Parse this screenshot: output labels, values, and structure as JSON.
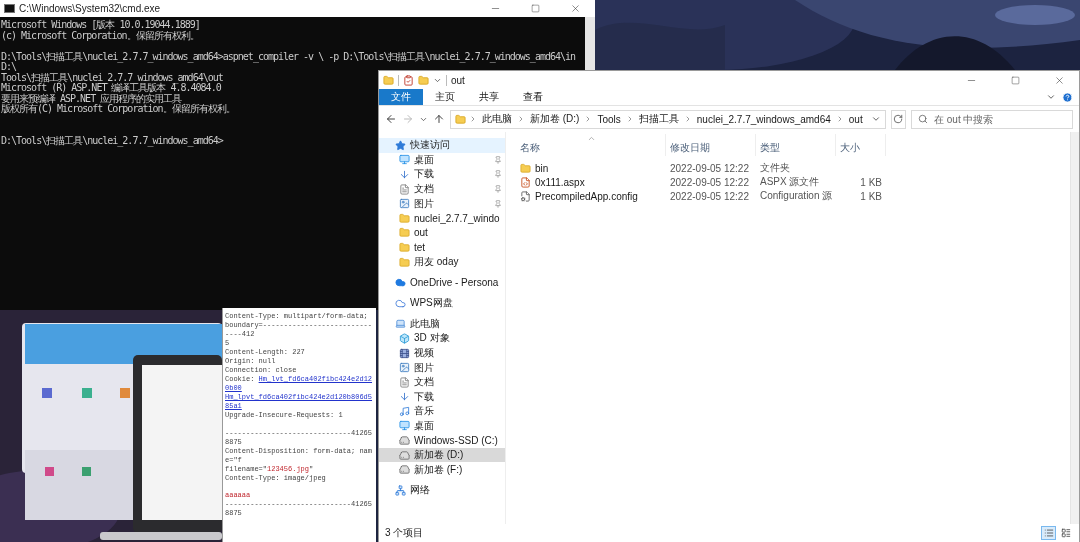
{
  "cmd_window": {
    "title": "C:\\Windows\\System32\\cmd.exe",
    "lines": [
      {
        "kind": "text",
        "text": "Microsoft Windows [版本 10.0.19044.1889]"
      },
      {
        "kind": "text",
        "text": "(c) Microsoft Corporation。保留所有权利。"
      },
      {
        "kind": "blank"
      },
      {
        "kind": "text",
        "text": "D:\\Tools\\扫描工具\\nuclei_2.7.7_windows_amd64>aspnet_compiler -v \\ -p D:\\Tools\\扫描工具\\nuclei_2.7.7_windows_amd64\\in D:\\"
      },
      {
        "kind": "text",
        "text": "Tools\\扫描工具\\nuclei_2.7.7_windows_amd64\\out"
      },
      {
        "kind": "text",
        "text": "Microsoft (R) ASP.NET 编译工具版本 4.8.4084.0"
      },
      {
        "kind": "text",
        "text": "要用来预编译 ASP.NET 应用程序的实用工具"
      },
      {
        "kind": "text",
        "text": "版权所有(C) Microsoft Corporation。保留所有权利。"
      },
      {
        "kind": "blank"
      },
      {
        "kind": "blank"
      },
      {
        "kind": "text",
        "text": "D:\\Tools\\扫描工具\\nuclei_2.7.7_windows_amd64>"
      }
    ]
  },
  "request_panel": {
    "lines": [
      {
        "kind": "text",
        "segments": [
          {
            "kind": "plain",
            "text": "Content-Type: multipart/form-data;"
          }
        ]
      },
      {
        "kind": "text",
        "segments": [
          {
            "kind": "plain",
            "text": "boundary=------------------------------412"
          }
        ]
      },
      {
        "kind": "text",
        "segments": [
          {
            "kind": "plain",
            "text": "5"
          }
        ]
      },
      {
        "kind": "text",
        "segments": [
          {
            "kind": "plain",
            "text": "Content-Length: 227"
          }
        ]
      },
      {
        "kind": "text",
        "segments": [
          {
            "kind": "plain",
            "text": "Origin: null"
          }
        ]
      },
      {
        "kind": "text",
        "segments": [
          {
            "kind": "plain",
            "text": "Connection: close"
          }
        ]
      },
      {
        "kind": "text",
        "segments": [
          {
            "kind": "plain",
            "text": "Cookie: "
          },
          {
            "kind": "link",
            "text": "Hm_lvt_fd6ca402fibc424e2d120b00"
          }
        ]
      },
      {
        "kind": "text",
        "segments": [
          {
            "kind": "link",
            "text": "Hm_lpvt_fd6ca402fibc424e2d120b806d585a1"
          }
        ]
      },
      {
        "kind": "text",
        "segments": [
          {
            "kind": "plain",
            "text": "Upgrade-Insecure-Requests: 1"
          }
        ]
      },
      {
        "kind": "blank"
      },
      {
        "kind": "text",
        "segments": [
          {
            "kind": "plain",
            "text": "------------------------------412658875"
          }
        ]
      },
      {
        "kind": "text",
        "segments": [
          {
            "kind": "plain",
            "text": "Content-Disposition: form-data; name=\"f"
          }
        ]
      },
      {
        "kind": "text",
        "segments": [
          {
            "kind": "plain",
            "text": "filename=\""
          },
          {
            "kind": "value",
            "text": "123456.jpg"
          },
          {
            "kind": "plain",
            "text": "\""
          }
        ]
      },
      {
        "kind": "text",
        "segments": [
          {
            "kind": "plain",
            "text": "Content-Type: image/jpeg"
          }
        ]
      },
      {
        "kind": "blank"
      },
      {
        "kind": "text",
        "segments": [
          {
            "kind": "value",
            "text": "aaaaaa"
          }
        ]
      },
      {
        "kind": "text",
        "segments": [
          {
            "kind": "plain",
            "text": "------------------------------412658875"
          }
        ]
      }
    ]
  },
  "explorer": {
    "title": "out",
    "ribbon_tabs": [
      {
        "label": "文件",
        "selected": true
      },
      {
        "label": "主页",
        "selected": false
      },
      {
        "label": "共享",
        "selected": false
      },
      {
        "label": "查看",
        "selected": false
      }
    ],
    "breadcrumb": [
      "此电脑",
      "新加卷 (D:)",
      "Tools",
      "扫描工具",
      "nuclei_2.7.7_windows_amd64",
      "out"
    ],
    "search": {
      "placeholder": "在 out 中搜索"
    },
    "nav": [
      {
        "label": "快速访问",
        "kind": "star",
        "selected": false,
        "hovered": true,
        "children": [
          {
            "label": "桌面",
            "kind": "desktop",
            "pinned": true,
            "selected": false,
            "hovered": false
          },
          {
            "label": "下载",
            "kind": "download",
            "pinned": true,
            "selected": false,
            "hovered": false
          },
          {
            "label": "文档",
            "kind": "document",
            "pinned": true,
            "selected": false,
            "hovered": false
          },
          {
            "label": "图片",
            "kind": "picture",
            "pinned": true,
            "selected": false,
            "hovered": false
          },
          {
            "label": "nuclei_2.7.7_windo",
            "kind": "folder",
            "pinned": false,
            "selected": false,
            "hovered": false
          },
          {
            "label": "out",
            "kind": "folder",
            "pinned": false,
            "selected": false,
            "hovered": false
          },
          {
            "label": "tet",
            "kind": "folder",
            "pinned": false,
            "selected": false,
            "hovered": false
          },
          {
            "label": "用友 oday",
            "kind": "folder",
            "pinned": false,
            "selected": false,
            "hovered": false
          }
        ]
      },
      {
        "label": "OneDrive - Persona",
        "kind": "cloud",
        "selected": false,
        "hovered": false
      },
      {
        "label": "WPS网盘",
        "kind": "wps",
        "selected": false,
        "hovered": false
      },
      {
        "label": "此电脑",
        "kind": "computer",
        "selected": false,
        "hovered": false,
        "children": [
          {
            "label": "3D 对象",
            "kind": "cube",
            "selected": false,
            "hovered": false
          },
          {
            "label": "视频",
            "kind": "video",
            "selected": false,
            "hovered": false
          },
          {
            "label": "图片",
            "kind": "picture",
            "selected": false,
            "hovered": false
          },
          {
            "label": "文档",
            "kind": "document",
            "selected": false,
            "hovered": false
          },
          {
            "label": "下载",
            "kind": "download",
            "selected": false,
            "hovered": false
          },
          {
            "label": "音乐",
            "kind": "music",
            "selected": false,
            "hovered": false
          },
          {
            "label": "桌面",
            "kind": "desktop",
            "selected": false,
            "hovered": false
          },
          {
            "label": "Windows-SSD (C:)",
            "kind": "drive",
            "selected": false,
            "hovered": false
          },
          {
            "label": "新加卷 (D:)",
            "kind": "drive",
            "selected": true,
            "hovered": false
          },
          {
            "label": "新加卷 (F:)",
            "kind": "drive",
            "selected": false,
            "hovered": false
          }
        ]
      },
      {
        "label": "网络",
        "kind": "network",
        "selected": false,
        "hovered": false
      }
    ],
    "columns": [
      {
        "label": "名称",
        "sorted": true
      },
      {
        "label": "修改日期",
        "sorted": false
      },
      {
        "label": "类型",
        "sorted": false
      },
      {
        "label": "大小",
        "sorted": false
      }
    ],
    "files": [
      {
        "name": "bin",
        "kind": "folder",
        "modified": "2022-09-05 12:22",
        "type": "文件夹"
      },
      {
        "name": "0x111.aspx",
        "kind": "aspx",
        "modified": "2022-09-05 12:22",
        "type": "ASPX 源文件",
        "size": "1 KB"
      },
      {
        "name": "PrecompiledApp.config",
        "kind": "config",
        "modified": "2022-09-05 12:22",
        "type": "Configuration 源",
        "size": "1 KB"
      }
    ],
    "status": "3 个项目",
    "view_buttons": [
      {
        "kind": "details",
        "selected": true
      },
      {
        "kind": "tiles",
        "selected": false
      }
    ]
  }
}
